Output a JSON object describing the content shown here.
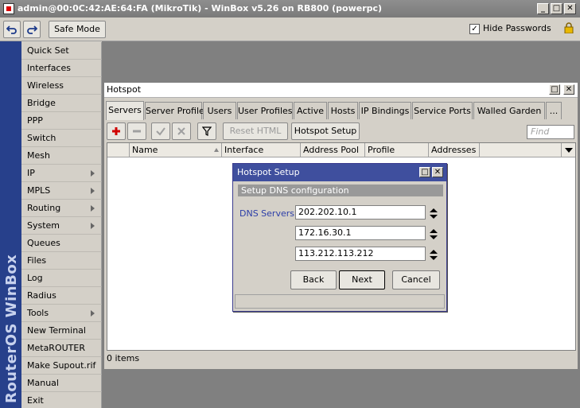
{
  "window": {
    "title": "admin@00:0C:42:AE:64:FA (MikroTik) - WinBox v5.26 on RB800 (powerpc)"
  },
  "toolbar": {
    "undo_icon": "undo-icon",
    "redo_icon": "redo-icon",
    "safe_mode_label": "Safe Mode",
    "hide_passwords_label": "Hide Passwords",
    "hide_passwords_checked": true
  },
  "sidebar": {
    "brand": "RouterOS WinBox",
    "items": [
      {
        "label": "Quick Set",
        "submenu": false
      },
      {
        "label": "Interfaces",
        "submenu": false
      },
      {
        "label": "Wireless",
        "submenu": false
      },
      {
        "label": "Bridge",
        "submenu": false
      },
      {
        "label": "PPP",
        "submenu": false
      },
      {
        "label": "Switch",
        "submenu": false
      },
      {
        "label": "Mesh",
        "submenu": false
      },
      {
        "label": "IP",
        "submenu": true
      },
      {
        "label": "MPLS",
        "submenu": true
      },
      {
        "label": "Routing",
        "submenu": true
      },
      {
        "label": "System",
        "submenu": true
      },
      {
        "label": "Queues",
        "submenu": false
      },
      {
        "label": "Files",
        "submenu": false
      },
      {
        "label": "Log",
        "submenu": false
      },
      {
        "label": "Radius",
        "submenu": false
      },
      {
        "label": "Tools",
        "submenu": true
      },
      {
        "label": "New Terminal",
        "submenu": false
      },
      {
        "label": "MetaROUTER",
        "submenu": false
      },
      {
        "label": "Make Supout.rif",
        "submenu": false
      },
      {
        "label": "Manual",
        "submenu": false
      },
      {
        "label": "Exit",
        "submenu": false
      }
    ]
  },
  "hotspot": {
    "title": "Hotspot",
    "tabs": [
      "Servers",
      "Server Profiles",
      "Users",
      "User Profiles",
      "Active",
      "Hosts",
      "IP Bindings",
      "Service Ports",
      "Walled Garden",
      "..."
    ],
    "active_tab": "Servers",
    "reset_html_label": "Reset HTML",
    "hotspot_setup_label": "Hotspot Setup",
    "find_placeholder": "Find",
    "columns": [
      "",
      "Name",
      "Interface",
      "Address Pool",
      "Profile",
      "Addresses ..."
    ],
    "status": "0 items"
  },
  "setup_dialog": {
    "title": "Hotspot Setup",
    "section": "Setup DNS configuration",
    "dns_label": "DNS Servers:",
    "dns_servers": [
      "202.202.10.1",
      "172.16.30.1",
      "113.212.113.212"
    ],
    "back_label": "Back",
    "next_label": "Next",
    "cancel_label": "Cancel"
  }
}
